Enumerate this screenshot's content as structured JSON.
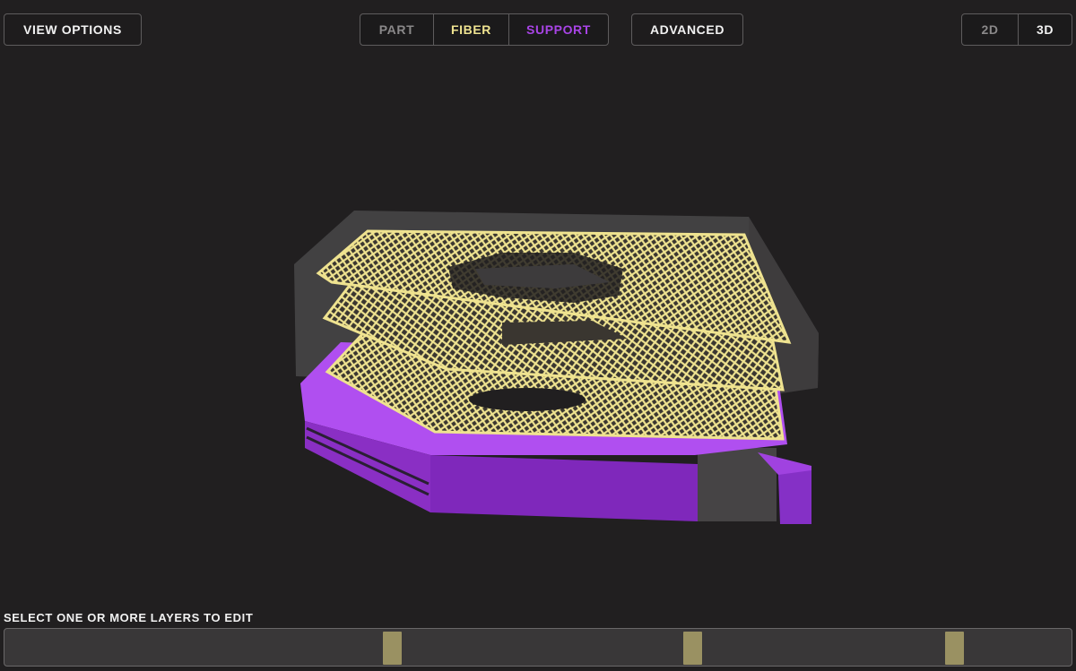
{
  "toolbar": {
    "view_options_label": "VIEW OPTIONS",
    "advanced_label": "ADVANCED",
    "material_tabs": [
      {
        "label": "PART",
        "color": "#8a8889"
      },
      {
        "label": "FIBER",
        "color": "#efe390"
      },
      {
        "label": "SUPPORT",
        "color": "#a844e6"
      }
    ],
    "view_modes": [
      {
        "label": "2D",
        "color": "#8a8889"
      },
      {
        "label": "3D",
        "color": "#f2f2f2"
      }
    ]
  },
  "layers": {
    "instruction": "SELECT ONE OR MORE LAYERS TO EDIT",
    "marker_positions_fraction": [
      0.363,
      0.644,
      0.889
    ]
  },
  "colors": {
    "background": "#211f20",
    "fiber": "#efe390",
    "support": "#a844e6",
    "part": "#4a4849"
  }
}
